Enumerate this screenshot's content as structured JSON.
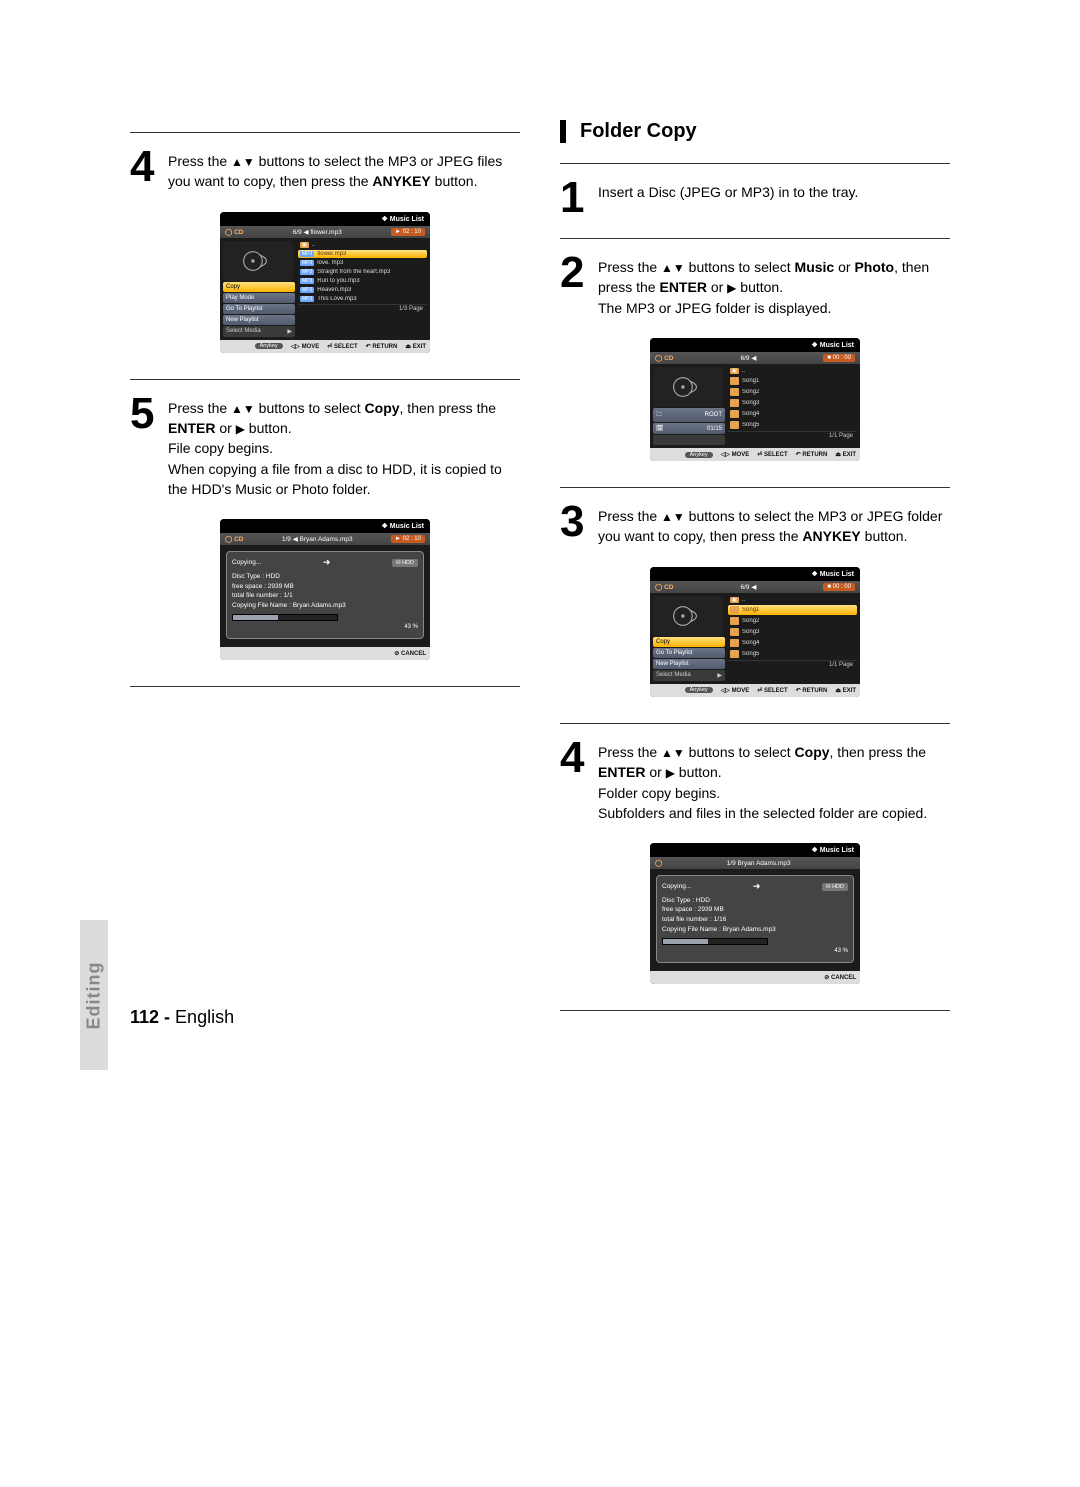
{
  "left": {
    "step4": {
      "text_a": "Press the ",
      "text_b": " buttons to select the MP3 or JPEG files you want to copy, then press the ",
      "bold_c": "ANYKEY",
      "text_d": " button."
    },
    "step5": {
      "text_a": "Press the ",
      "text_b": " buttons to select ",
      "bold_c": "Copy",
      "text_d": ", then press the ",
      "bold_e": "ENTER",
      "text_f": " or ",
      "text_g": " button.",
      "line2": "File copy begins.",
      "line3": "When copying a file from a disc to HDD, it is copied to the HDD's Music or Photo folder."
    }
  },
  "right": {
    "heading": "Folder Copy",
    "step1": "Insert a Disc (JPEG or MP3) in to the tray.",
    "step2": {
      "text_a": "Press the ",
      "text_b": " buttons to select ",
      "bold_c": "Music",
      "text_d": " or ",
      "bold_e": "Photo",
      "text_f": ", then press the ",
      "bold_g": "ENTER",
      "text_h": " or ",
      "text_i": " button.",
      "line2": "The MP3 or JPEG folder is displayed."
    },
    "step3": {
      "text_a": "Press the ",
      "text_b": " buttons to select the MP3 or JPEG folder you want to copy, then press the ",
      "bold_c": "ANYKEY",
      "text_d": " button."
    },
    "step4": {
      "text_a": "Press the ",
      "text_b": " buttons to select ",
      "bold_c": "Copy",
      "text_d": ", then press the ",
      "bold_e": "ENTER",
      "text_f": " or ",
      "text_g": " button.",
      "line2": "Folder copy begins.",
      "line3": "Subfolders and files in the selected folder are copied."
    }
  },
  "shotA": {
    "title": "Music List",
    "cd": "CD",
    "track": "flower.mp3",
    "trackno": "6/9",
    "time": "► 02 : 10",
    "menu": [
      "Copy",
      "Play Mode",
      "Go To Playlist",
      "New Playlist",
      "Select Media"
    ],
    "files": [
      "..",
      "flower.mp3",
      "love. mp3",
      "Straight from the heart.mp3",
      "Run to you.mp3",
      "Heaven.mp3",
      "This Love.mp3"
    ],
    "page": "1/3 Page",
    "foot": {
      "anykey": "Anykey",
      "move": "MOVE",
      "select": "SELECT",
      "return": "RETURN",
      "exit": "EXIT"
    }
  },
  "shotB": {
    "title": "Music List",
    "cd": "CD",
    "track": "Bryan Adams.mp3",
    "trackno": "1/9",
    "time": "► 02 : 10",
    "overlay": {
      "copying": "Copying...",
      "disc": "Disc Type : HDD",
      "free": "free space : 2939 MB",
      "total": "total file number : 1/1",
      "file": "Copying File Name : Bryan Adams.mp3",
      "pct": "43 %",
      "hdd": "HDD"
    },
    "cancel": "CANCEL"
  },
  "shotC": {
    "title": "Music List",
    "cd": "CD",
    "trackno": "6/9",
    "time": "■ 00 : 00",
    "sidebar": {
      "root": "ROOT",
      "date": "01/15"
    },
    "songs": [
      "..",
      "Song1",
      "Song2",
      "Song3",
      "Song4",
      "Song5"
    ],
    "page": "1/1 Page",
    "foot": {
      "anykey": "Anykey",
      "move": "MOVE",
      "select": "SELECT",
      "return": "RETURN",
      "exit": "EXIT"
    }
  },
  "shotD": {
    "title": "Music List",
    "cd": "CD",
    "trackno": "6/9",
    "time": "■ 00 : 00",
    "menu": [
      "Copy",
      "Go To Playlist",
      "New Playlist",
      "Select Media"
    ],
    "songs": [
      "..",
      "Song1",
      "Song2",
      "Song3",
      "Song4",
      "Song5"
    ],
    "page": "1/1 Page",
    "foot": {
      "anykey": "Anykey",
      "move": "MOVE",
      "select": "SELECT",
      "return": "RETURN",
      "exit": "EXIT"
    }
  },
  "shotE": {
    "title": "Music List",
    "track": "Bryan Adams.mp3",
    "trackno": "1/9",
    "overlay": {
      "copying": "Copying...",
      "disc": "Disc Type : HDD",
      "free": "free space : 2939 MB",
      "total": "total file number : 1/16",
      "file": "Copying File Name : Bryan Adams.mp3",
      "pct": "43 %",
      "hdd": "HDD"
    },
    "cancel": "CANCEL"
  },
  "sidebar_label": "Editing",
  "footer": {
    "num": "112 - ",
    "lang": "English"
  }
}
